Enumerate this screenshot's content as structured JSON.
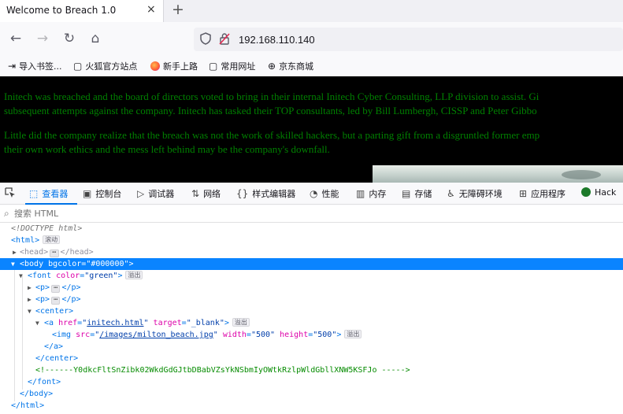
{
  "tab": {
    "title": "Welcome to Breach 1.0",
    "close_glyph": "×",
    "new_tab_glyph": "+"
  },
  "nav": {
    "back_glyph": "←",
    "forward_glyph": "→",
    "reload_glyph": "↻",
    "home_glyph": "⌂",
    "url": "192.168.110.140"
  },
  "bookmarks": [
    {
      "label": "导入书签...",
      "icon": "import-icon"
    },
    {
      "label": "火狐官方站点",
      "icon": "folder-icon"
    },
    {
      "label": "新手上路",
      "icon": "firefox-icon"
    },
    {
      "label": "常用网址",
      "icon": "folder-icon"
    },
    {
      "label": "京东商城",
      "icon": "globe-icon"
    }
  ],
  "page": {
    "para1_line1": "Initech was breached and the board of directors voted to bring in their internal Initech Cyber Consulting, LLP division to assist. Gi",
    "para1_line2": "subsequent attempts against the company. Initech has tasked their TOP consultants, led by Bill Lumbergh, CISSP and Peter Gibbo",
    "para2_line1": "Little did the company realize that the breach was not the work of skilled hackers, but a parting gift from a disgruntled former emp",
    "para2_line2": "their own work ethics and the mess left behind may be the company's downfall.",
    "text_color": "#008000",
    "background": "#000000"
  },
  "devtools": {
    "tabs": [
      {
        "label": "查看器",
        "icon": "inspector-icon",
        "active": true
      },
      {
        "label": "控制台",
        "icon": "console-icon",
        "active": false
      },
      {
        "label": "调试器",
        "icon": "debugger-icon",
        "active": false
      },
      {
        "label": "网络",
        "icon": "network-icon",
        "active": false
      },
      {
        "label": "样式编辑器",
        "icon": "style-editor-icon",
        "active": false
      },
      {
        "label": "性能",
        "icon": "performance-icon",
        "active": false
      },
      {
        "label": "内存",
        "icon": "memory-icon",
        "active": false
      },
      {
        "label": "存储",
        "icon": "storage-icon",
        "active": false
      },
      {
        "label": "无障碍环境",
        "icon": "accessibility-icon",
        "active": false
      },
      {
        "label": "应用程序",
        "icon": "application-icon",
        "active": false
      },
      {
        "label": "Hack",
        "icon": "hackbar-icon",
        "active": false
      }
    ],
    "search_placeholder": "搜索 HTML",
    "accent": "#0074e8",
    "selection": "#0a84ff"
  },
  "markup": {
    "doctype": "<!DOCTYPE html>",
    "html_open": "<html>",
    "badge_scroll": "滚动",
    "badge_event": "溢出",
    "head_open": "<head>",
    "head_close": "</head>",
    "body_open_tag": "<body",
    "body_attr": "bgcolor",
    "body_val": "\"#000000\"",
    "font_tag": "<font",
    "font_attr": "color",
    "font_val": "\"green\"",
    "p_open": "<p>",
    "p_close": "</p>",
    "center_open": "<center>",
    "a_tag": "<a",
    "a_href_attr": "href",
    "a_href_val": "initech.html",
    "a_target_attr": "target",
    "a_target_val": "\"_blank\"",
    "img_tag": "<img",
    "img_src_attr": "src",
    "img_src_val": "/images/milton_beach.jpg",
    "img_w_attr": "width",
    "img_w_val": "\"500\"",
    "img_h_attr": "height",
    "img_h_val": "\"500\"",
    "a_close": "</a>",
    "center_close": "</center>",
    "comment": "<!------Y0dkcFltSnZibk02WkdGdGJtbDBabVZsYkNSbmIyOWtkRzlpWldGbllXNW5KSFJo ----->",
    "font_close": "</font>",
    "body_close": "</body>",
    "html_close": "</html>",
    "ellipsis": "⋯",
    "gt": ">",
    "eq": "="
  }
}
